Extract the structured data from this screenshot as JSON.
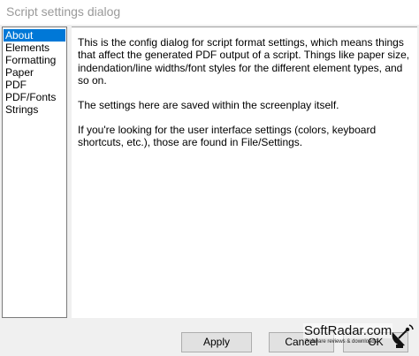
{
  "window": {
    "title": "Script settings dialog"
  },
  "sidebar": {
    "items": [
      {
        "label": "About",
        "selected": true
      },
      {
        "label": "Elements",
        "selected": false
      },
      {
        "label": "Formatting",
        "selected": false
      },
      {
        "label": "Paper",
        "selected": false
      },
      {
        "label": "PDF",
        "selected": false
      },
      {
        "label": "PDF/Fonts",
        "selected": false
      },
      {
        "label": "Strings",
        "selected": false
      }
    ]
  },
  "content": {
    "paragraphs": [
      "This is the config dialog for script format settings, which means things that affect the generated PDF output of a script. Things like paper size, indendation/line widths/font styles for the different element types, and so on.",
      "The settings here are saved within the screenplay itself.",
      "If you're looking for the user interface settings (colors, keyboard shortcuts, etc.), those are found in File/Settings."
    ]
  },
  "buttons": {
    "apply": "Apply",
    "cancel": "Cancel",
    "ok": "OK"
  },
  "watermark": {
    "brand": "SoftRadar.com",
    "tagline": "Software reviews & downloads",
    "icon": "satellite-dish-icon"
  },
  "colors": {
    "selection": "#0078d7",
    "title_text": "#9a9a9a",
    "dialog_bg": "#f0f0f0"
  }
}
